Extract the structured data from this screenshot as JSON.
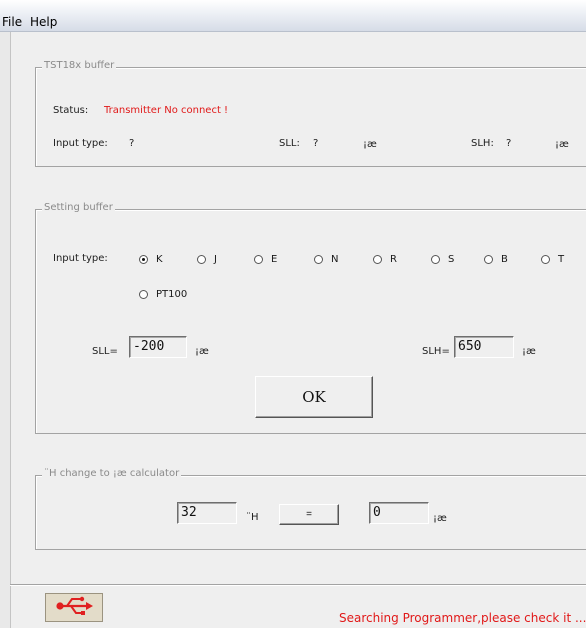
{
  "menubar": {
    "file": "File",
    "help": "Help"
  },
  "buffer": {
    "title": "TST18x buffer",
    "status_label": "Status:",
    "status_value": "Transmitter No connect !",
    "input_type_label": "Input type:",
    "input_type_value": "?",
    "sll_label": "SLL:",
    "sll_value": "?",
    "sll_unit": "¡æ",
    "slh_label": "SLH:",
    "slh_value": "?",
    "slh_unit": "¡æ"
  },
  "setting": {
    "title": "Setting buffer",
    "input_type_label": "Input type:",
    "types": [
      {
        "label": "K",
        "selected": true
      },
      {
        "label": "J",
        "selected": false
      },
      {
        "label": "E",
        "selected": false
      },
      {
        "label": "N",
        "selected": false
      },
      {
        "label": "R",
        "selected": false
      },
      {
        "label": "S",
        "selected": false
      },
      {
        "label": "B",
        "selected": false
      },
      {
        "label": "T",
        "selected": false
      },
      {
        "label": "PT100",
        "selected": false
      }
    ],
    "sll_label": "SLL=",
    "sll_value": "-200",
    "sll_unit": "¡æ",
    "slh_label": "SLH=",
    "slh_value": "650",
    "slh_unit": "¡æ",
    "ok_label": "OK"
  },
  "calculator": {
    "title": "¨H change to ¡æ calculator",
    "f_value": "32",
    "f_unit": "¨H",
    "equals_label": "=",
    "c_value": "0",
    "c_unit": "¡æ"
  },
  "statusbar": {
    "usb_icon": "usb-icon",
    "message": "Searching Programmer,please check it ..."
  },
  "colors": {
    "accent_red": "#e11919",
    "background": "#efefef"
  }
}
